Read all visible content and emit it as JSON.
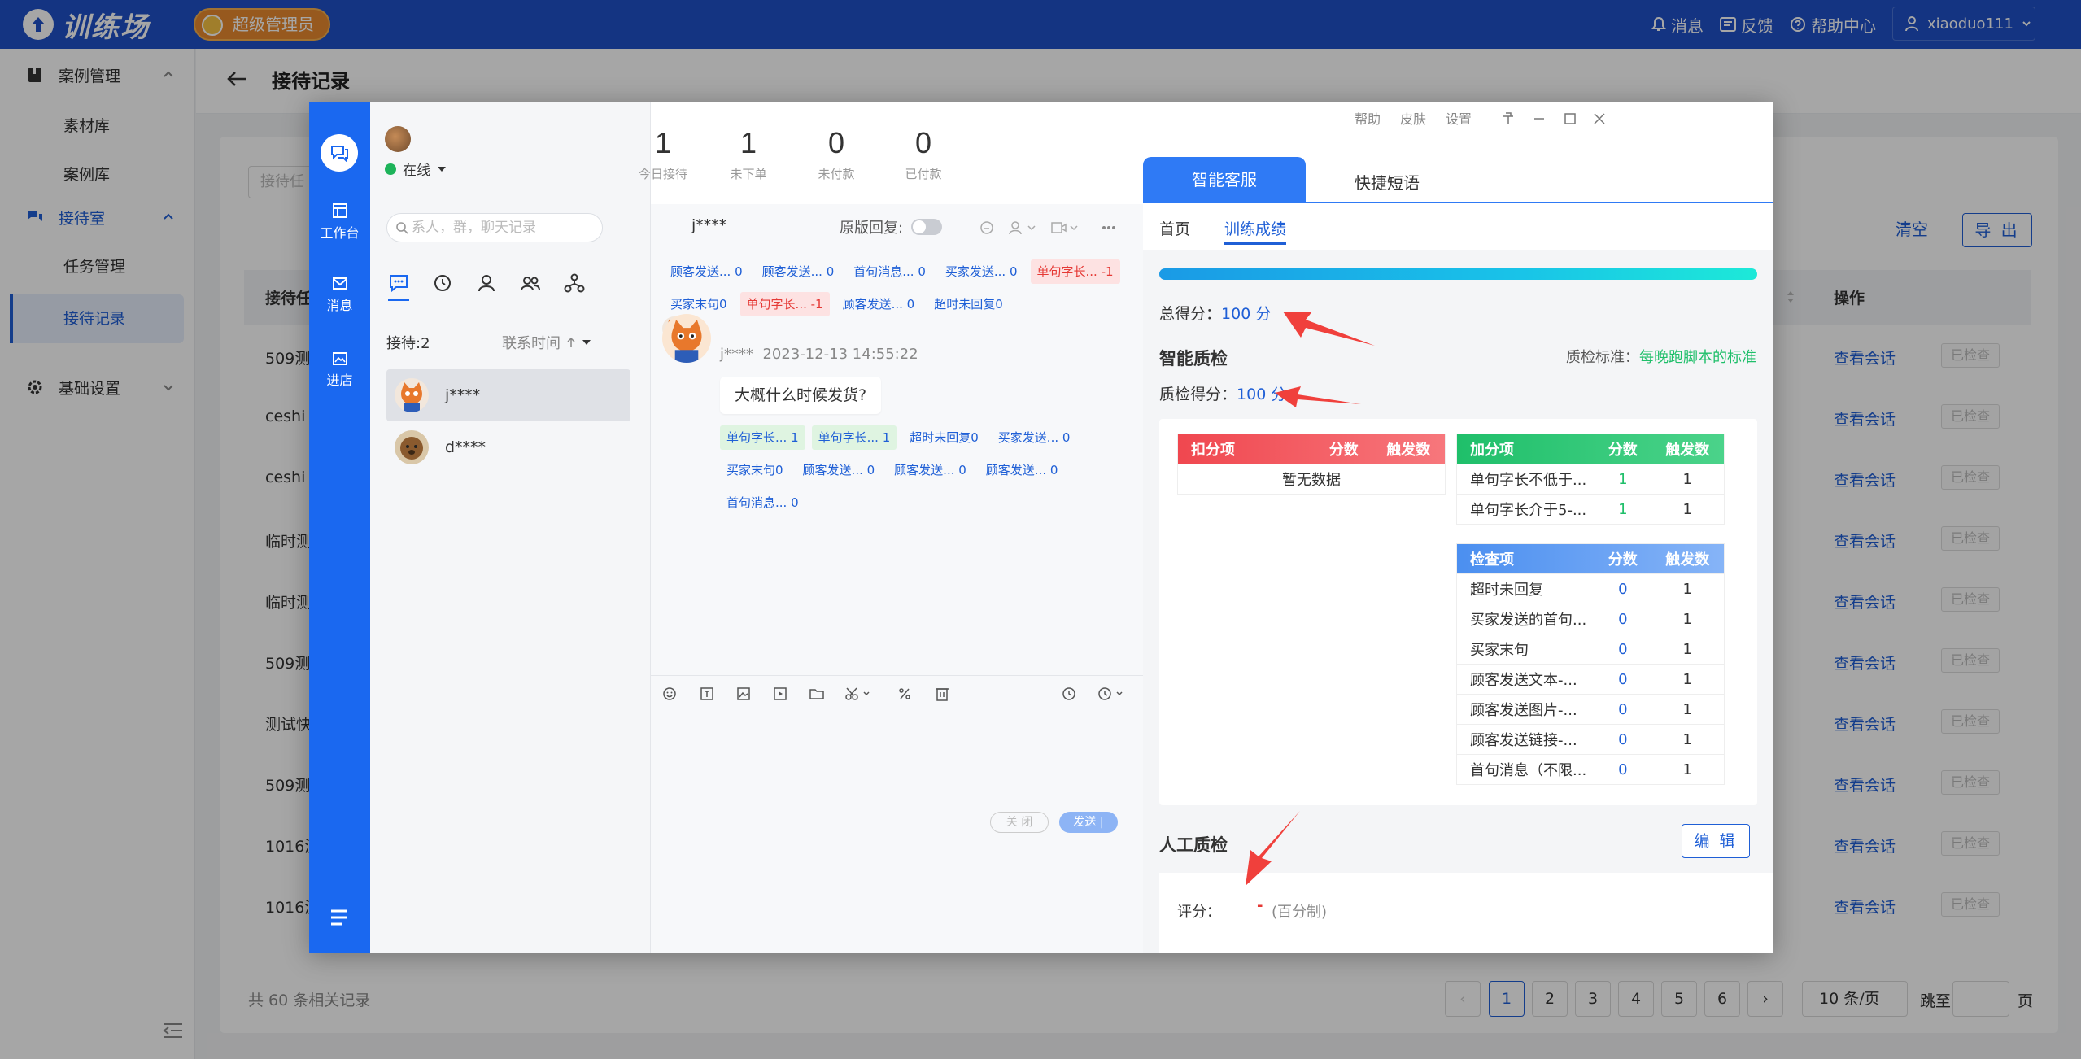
{
  "app": {
    "name": "训练场",
    "role_badge": "超级管理员",
    "top_links": {
      "messages": "消息",
      "feedback": "反馈",
      "help": "帮助中心"
    },
    "user": "xiaoduo111"
  },
  "sidebar": {
    "case_mgmt": "案例管理",
    "material_lib": "素材库",
    "case_lib": "案例库",
    "reception_room": "接待室",
    "task_mgmt": "任务管理",
    "reception_records": "接待记录",
    "basic_settings": "基础设置"
  },
  "page": {
    "title": "接待记录",
    "search_placeholder": "接待任",
    "clear": "清空",
    "export": "导 出",
    "col_task": "接待任",
    "col_action": "操作",
    "rows": [
      {
        "name": "509测",
        "action": "查看会话",
        "status": "已检查"
      },
      {
        "name": "ceshi",
        "action": "查看会话",
        "status": "已检查"
      },
      {
        "name": "ceshi",
        "action": "查看会话",
        "status": "已检查"
      },
      {
        "name": "临时测",
        "action": "查看会话",
        "status": "已检查"
      },
      {
        "name": "临时测",
        "action": "查看会话",
        "status": "已检查"
      },
      {
        "name": "509测",
        "action": "查看会话",
        "status": "已检查"
      },
      {
        "name": "测试快",
        "action": "查看会话",
        "status": "已检查"
      },
      {
        "name": "509测",
        "action": "查看会话",
        "status": "已检查"
      },
      {
        "name": "1016测",
        "action": "查看会话",
        "status": "已检查"
      },
      {
        "name": "1016测",
        "action": "查看会话",
        "status": "已检查"
      }
    ],
    "total_records": "共 60 条相关记录",
    "pages": [
      "1",
      "2",
      "3",
      "4",
      "5",
      "6"
    ],
    "current_page": "1",
    "page_size": "10 条/页",
    "goto_label": "跳至",
    "goto_unit": "页"
  },
  "chat": {
    "rail": {
      "workbench": "工作台",
      "messages": "消息",
      "store": "进店"
    },
    "status": "在线",
    "search_placeholder": "搜索人、群、聊天记录",
    "search_visible": "系人，群，聊天记录",
    "waiting": "接待:2",
    "sort_by": "联系时间",
    "contacts": [
      {
        "name": "j****"
      },
      {
        "name": "d****"
      }
    ],
    "stats": [
      {
        "value": "1",
        "label": "今日接待"
      },
      {
        "value": "1",
        "label": "未下单"
      },
      {
        "value": "0",
        "label": "未付款"
      },
      {
        "value": "0",
        "label": "已付款"
      }
    ],
    "conv_name": "j****",
    "original_reply": "原版回复:",
    "top_tags": [
      {
        "text": "顾客发送... 0",
        "style": "plain"
      },
      {
        "text": "顾客发送... 0",
        "style": "plain"
      },
      {
        "text": "首句消息... 0",
        "style": "plain"
      },
      {
        "text": "买家发送... 0",
        "style": "plain"
      },
      {
        "text": "单句字长... -1",
        "style": "red"
      },
      {
        "text": "买家末句0",
        "style": "plain"
      },
      {
        "text": "单句字长... -1",
        "style": "red"
      },
      {
        "text": "顾客发送... 0",
        "style": "plain"
      },
      {
        "text": "超时未回复0",
        "style": "plain"
      }
    ],
    "message": {
      "sender": "j****",
      "time": "2023-12-13 14:55:22",
      "text": "大概什么时候发货?"
    },
    "msg_tags": [
      {
        "text": "单句字长... 1",
        "style": "green"
      },
      {
        "text": "单句字长... 1",
        "style": "green"
      },
      {
        "text": "超时未回复0",
        "style": "plain"
      },
      {
        "text": "买家发送... 0",
        "style": "plain"
      },
      {
        "text": "买家末句0",
        "style": "plain"
      },
      {
        "text": "顾客发送... 0",
        "style": "plain"
      },
      {
        "text": "顾客发送... 0",
        "style": "plain"
      },
      {
        "text": "顾客发送... 0",
        "style": "plain"
      },
      {
        "text": "首句消息... 0",
        "style": "plain"
      }
    ],
    "close_btn": "关 闭",
    "send_btn": "发送 |"
  },
  "panel": {
    "top_links": [
      "帮助",
      "皮肤",
      "设置"
    ],
    "tab_smart": "智能客服",
    "tab_quick": "快捷短语",
    "sub_home": "首页",
    "sub_score": "训练成绩",
    "progress": 1.0,
    "total_label": "总得分：",
    "total_value": "100 分",
    "smart_qc": "智能质检",
    "qc_standard_label": "质检标准：",
    "qc_standard_value": "每晚跑脚本的标准",
    "qc_score_label": "质检得分：",
    "qc_score_value": "100 分",
    "deduct": {
      "headers": [
        "扣分项",
        "分数",
        "触发数"
      ],
      "empty": "暂无数据"
    },
    "bonus": {
      "headers": [
        "加分项",
        "分数",
        "触发数"
      ],
      "rows": [
        [
          "单句字长不低于...",
          "1",
          "1"
        ],
        [
          "单句字长介于5-...",
          "1",
          "1"
        ]
      ]
    },
    "check": {
      "headers": [
        "检查项",
        "分数",
        "触发数"
      ],
      "rows": [
        [
          "超时未回复",
          "0",
          "1"
        ],
        [
          "买家发送的首句...",
          "0",
          "1"
        ],
        [
          "买家末句",
          "0",
          "1"
        ],
        [
          "顾客发送文本-...",
          "0",
          "1"
        ],
        [
          "顾客发送图片-...",
          "0",
          "1"
        ],
        [
          "顾客发送链接-...",
          "0",
          "1"
        ],
        [
          "首句消息（不限...",
          "0",
          "1"
        ]
      ]
    },
    "manual_qc": "人工质检",
    "edit_btn": "编 辑",
    "rating_label": "评分：",
    "rating_value": "-",
    "rating_unit": "(百分制)"
  },
  "colors": {
    "topbar": "#1f50c8",
    "rail": "#1a68f0",
    "deduct_header": "#f0474f",
    "bonus_header": "#1fbf6a",
    "check_header": "#4b8ff0",
    "standard_green": "#1fbf6a",
    "annotation_arrow": "#f0403c"
  }
}
